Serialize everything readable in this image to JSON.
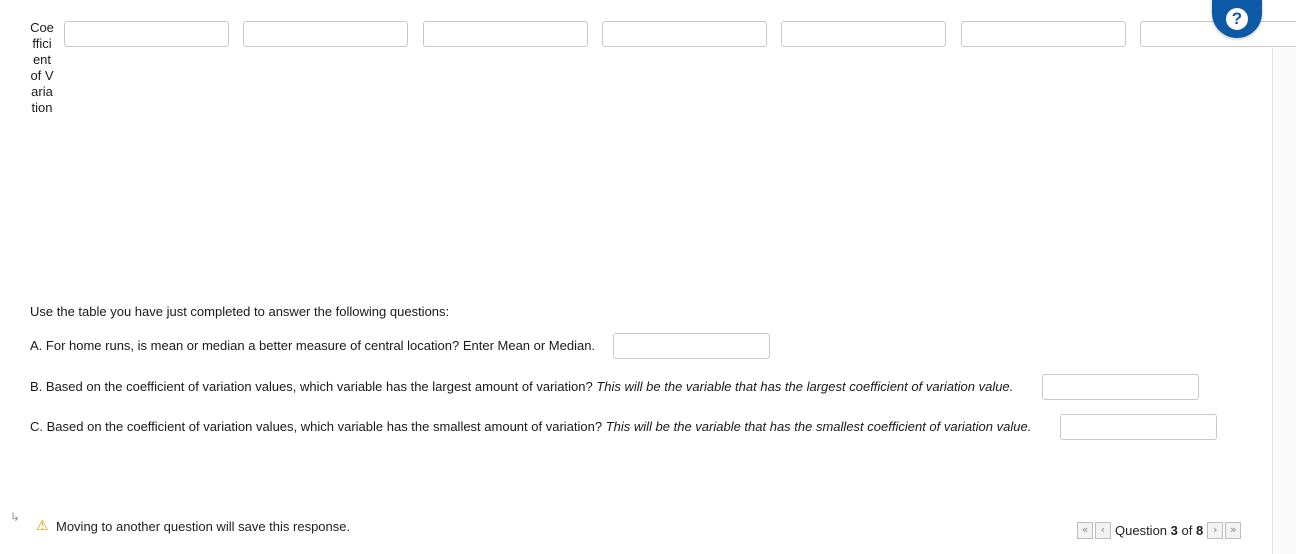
{
  "table": {
    "row_label": "Coefficient of Variation",
    "cells": [
      "",
      "",
      "",
      "",
      "",
      "",
      ""
    ]
  },
  "help": {
    "icon": "question-mark-icon",
    "glyph": "?"
  },
  "instructions": "Use the table you have just completed to answer the following questions:",
  "questions": {
    "a": {
      "text": "A. For home runs, is mean or median a better measure of central location? Enter Mean or Median.",
      "value": ""
    },
    "b": {
      "text": "B. Based on the coefficient of variation values, which variable has the largest amount of variation?",
      "hint": "This will be the variable that has the largest coefficient of variation value.",
      "value": ""
    },
    "c": {
      "text": "C. Based on the coefficient of variation values, which variable has the smallest amount of variation?",
      "hint": "This will be the variable that has the smallest coefficient of variation value.",
      "value": ""
    }
  },
  "footer": {
    "arrow": "↳",
    "warning_icon": "⚠",
    "save_message": "Moving to another question will save this response.",
    "pager": {
      "first": "«",
      "prev": "‹",
      "word": "Question",
      "current": "3",
      "of": "of",
      "total": "8",
      "next": "›",
      "last": "»"
    }
  },
  "colors": {
    "accent": "#0c5aa6",
    "warning": "#e0a000",
    "border": "#c9c9c9"
  }
}
